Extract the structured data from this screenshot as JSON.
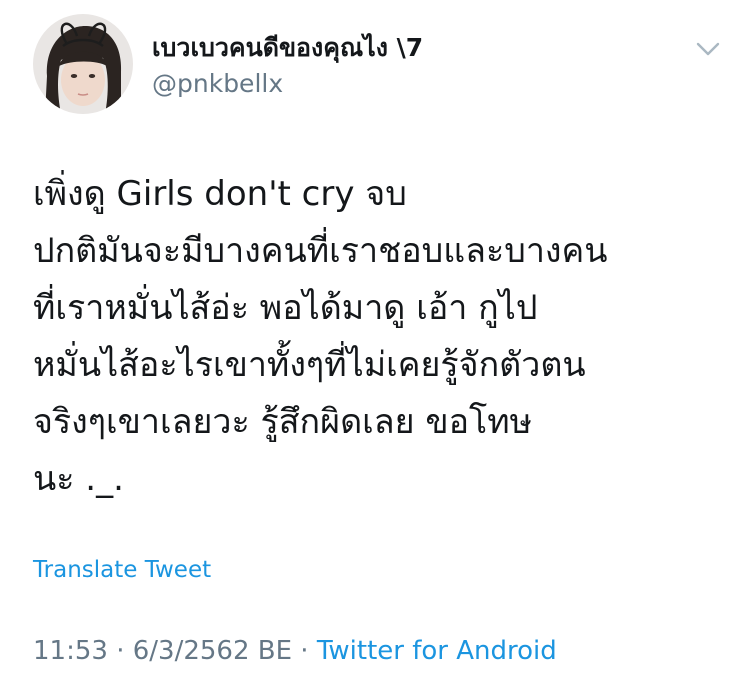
{
  "user": {
    "display_name": "เบวเบวคนดีของคุณไง \\7",
    "handle": "@pnkbellx"
  },
  "tweet": {
    "lines": [
      "เพิ่งดู Girls don't cry จบ",
      "ปกติมันจะมีบางคนที่เราชอบและบางคน",
      "ที่เราหมั่นไส้อ่ะ พอได้มาดู เอ้า กูไป",
      "หมั่นไส้อะไรเขาทั้งๆที่ไม่เคยรู้จักตัวตน",
      "จริงๆเขาเลยวะ รู้สึกผิดเลย ขอโทษ",
      "นะ ._."
    ],
    "translate_label": "Translate Tweet"
  },
  "meta": {
    "time": "11:53",
    "separator": " · ",
    "date": "6/3/2562 BE",
    "source": "Twitter for Android"
  },
  "colors": {
    "text": "#14171a",
    "secondary": "#657786",
    "link": "#1b95e0"
  },
  "icons": {
    "more": "chevron-down-icon",
    "avatar": "avatar"
  }
}
